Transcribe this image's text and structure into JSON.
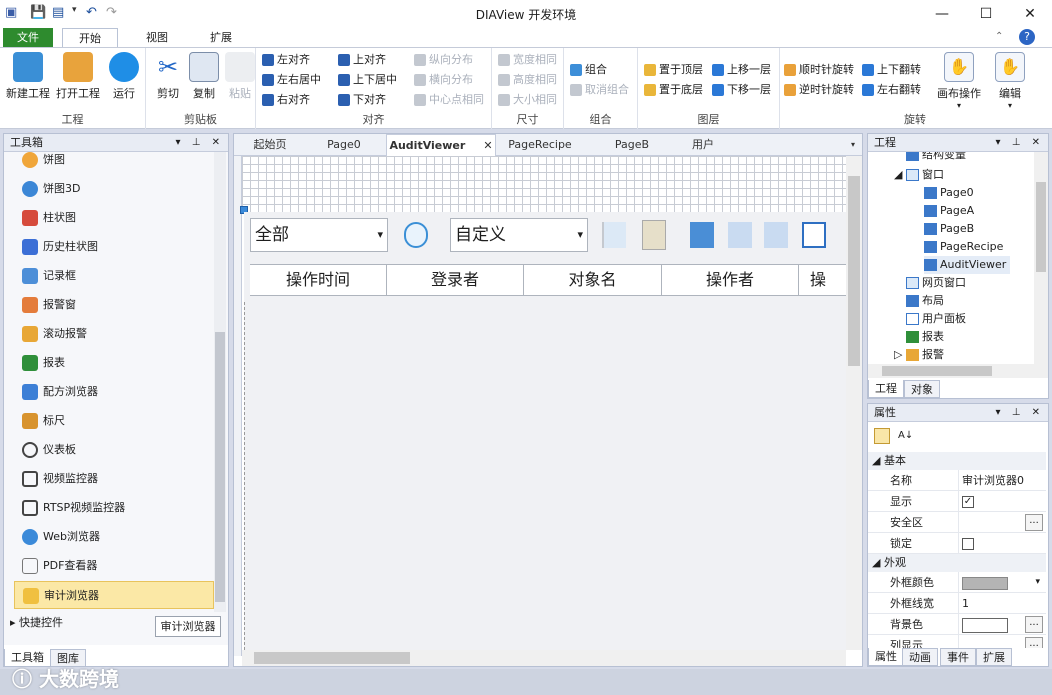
{
  "window": {
    "title": "DIAView 开发环境"
  },
  "ribbon_tabs": [
    "文件",
    "开始",
    "视图",
    "扩展"
  ],
  "groups": {
    "project": {
      "label": "工程",
      "new": "新建工程",
      "open": "打开工程",
      "run": "运行"
    },
    "clipboard": {
      "label": "剪贴板",
      "cut": "剪切",
      "copy": "复制",
      "paste": "粘贴"
    },
    "align": {
      "label": "对齐",
      "left": "左对齐",
      "hcenter": "左右居中",
      "right": "右对齐",
      "top": "上对齐",
      "vcenter": "上下居中",
      "bottom": "下对齐",
      "vdist": "纵向分布",
      "hdist": "横向分布",
      "cdist": "中心点相同"
    },
    "size": {
      "label": "尺寸",
      "w": "宽度相同",
      "h": "高度相同",
      "s": "大小相同"
    },
    "combine": {
      "label": "组合",
      "group": "组合",
      "ungroup": "取消组合"
    },
    "layer": {
      "label": "图层",
      "top": "置于顶层",
      "bottom": "置于底层",
      "up": "上移一层",
      "down": "下移一层"
    },
    "rotate": {
      "label": "旋转",
      "cw": "顺时针旋转",
      "ccw": "逆时针旋转",
      "vflip": "上下翻转",
      "hflip": "左右翻转",
      "canvas": "画布操作",
      "edit": "编辑"
    }
  },
  "toolbox": {
    "title": "工具箱",
    "items": [
      "饼图",
      "饼图3D",
      "柱状图",
      "历史柱状图",
      "记录框",
      "报警窗",
      "滚动报警",
      "报表",
      "配方浏览器",
      "标尺",
      "仪表板",
      "视频监控器",
      "RTSP视频监控器",
      "Web浏览器",
      "PDF查看器",
      "审计浏览器"
    ],
    "quick": "快捷控件",
    "tooltip": "审计浏览器",
    "bottom_tabs": [
      "工具箱",
      "图库"
    ]
  },
  "doc_tabs": [
    "起始页",
    "Page0",
    "AuditViewer",
    "PageRecipe",
    "PageB",
    "用户"
  ],
  "audit": {
    "filter1": "全部",
    "filter2": "自定义",
    "columns": [
      "操作时间",
      "登录者",
      "对象名",
      "操作者",
      "操"
    ]
  },
  "project_panel": {
    "title": "工程",
    "nodes": [
      "结构变量",
      "窗口",
      "Page0",
      "PageA",
      "PageB",
      "PageRecipe",
      "AuditViewer",
      "网页窗口",
      "布局",
      "用户面板",
      "报表",
      "报警"
    ],
    "bottom_tabs": [
      "工程",
      "对象"
    ]
  },
  "props": {
    "title": "属性",
    "cat_basic": "基本",
    "cat_look": "外观",
    "rows": {
      "name_k": "名称",
      "name_v": "审计浏览器0",
      "show_k": "显示",
      "safe_k": "安全区",
      "lock_k": "锁定",
      "border_k": "外框颜色",
      "bw_k": "外框线宽",
      "bw_v": "1",
      "bg_k": "背景色",
      "col_k": "列显示"
    },
    "bottom_tabs": [
      "属性",
      "动画",
      "事件",
      "扩展"
    ]
  },
  "watermark": "大数跨境"
}
